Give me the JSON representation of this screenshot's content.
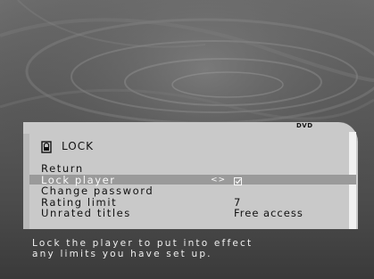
{
  "panel": {
    "tab_label": "DVD",
    "title": "LOCK"
  },
  "menu": {
    "items": [
      {
        "label": "Return",
        "value": ""
      },
      {
        "label": "Lock player",
        "value": ""
      },
      {
        "label": "Change password",
        "value": ""
      },
      {
        "label": "Rating limit",
        "value": "7"
      },
      {
        "label": "Unrated titles",
        "value": "Free access"
      }
    ],
    "selected_index": 1,
    "selected_arrows": "<>"
  },
  "help": {
    "line1": "Lock the player to put into effect",
    "line2": "any limits you have set up."
  },
  "icons": {
    "header": "lock-icon",
    "checkbox": "checkbox-checked-icon"
  },
  "colors": {
    "panel": "#c9c9c9",
    "highlight": "#9a9a9a",
    "text": "#111111",
    "selected_text": "#fafafa",
    "help_text": "#f0f0f0"
  }
}
